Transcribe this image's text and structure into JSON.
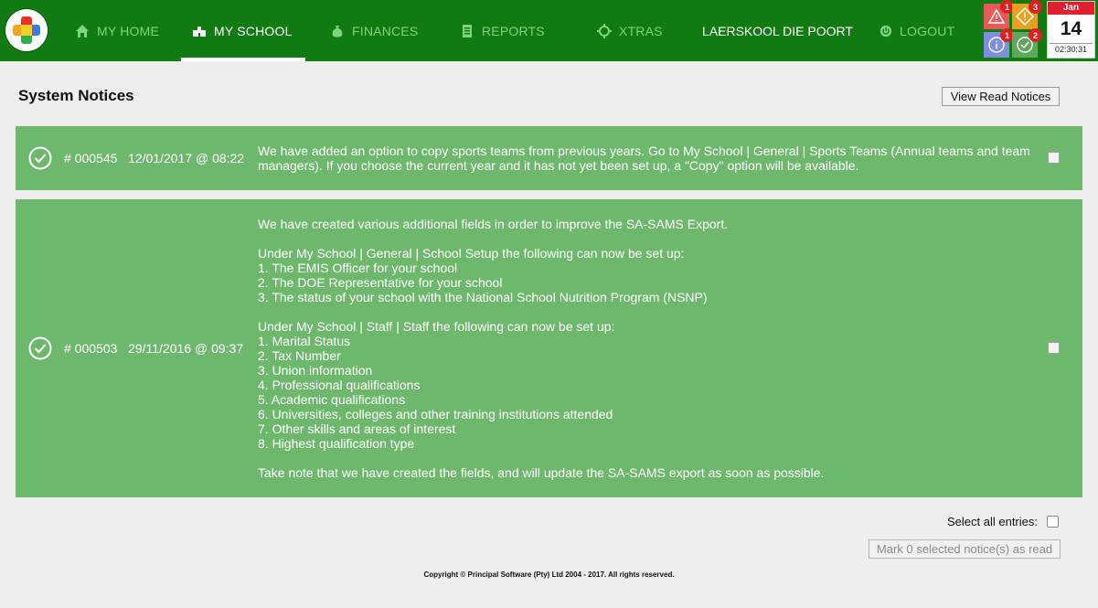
{
  "nav": {
    "items": [
      {
        "label": "MY HOME",
        "icon": "home-icon"
      },
      {
        "label": "MY SCHOOL",
        "icon": "school-icon",
        "active": true
      },
      {
        "label": "FINANCES",
        "icon": "money-bag-icon"
      },
      {
        "label": "REPORTS",
        "icon": "report-icon"
      },
      {
        "label": "XTRAS",
        "icon": "crosshair-icon"
      }
    ],
    "school_name": "LAERSKOOL DIE POORT",
    "logout": {
      "label": "LOGOUT",
      "icon": "power-icon"
    }
  },
  "notifications": [
    {
      "icon": "warning-triangle-icon",
      "count": "1",
      "color": "#e85a5a"
    },
    {
      "icon": "warning-diamond-icon",
      "count": "3",
      "color": "#e8a020"
    },
    {
      "icon": "info-icon",
      "count": "1",
      "color": "#7f8fe0"
    },
    {
      "icon": "check-icon",
      "count": "2",
      "color": "#5ea85e"
    }
  ],
  "calendar": {
    "month": "Jan",
    "day": "14",
    "time": "02:30:31"
  },
  "page": {
    "title": "System Notices",
    "view_read_button": "View Read Notices"
  },
  "notices": [
    {
      "number": "# 000545",
      "date": "12/01/2017 @ 08:22",
      "text": "We have added an option to copy sports teams from previous years. Go to My School | General | Sports Teams (Annual teams and team managers). If you choose the current year and it has not yet been set up, a \"Copy\" option will be available."
    },
    {
      "number": "# 000503",
      "date": "29/11/2016 @ 09:37",
      "text": "We have created various additional fields in order to improve the SA-SAMS Export.\n\nUnder My School | General | School Setup the following can now be set up:\n1. The EMIS Officer for your school\n2. The DOE Representative for your school\n3. The status of your school with the National School Nutrition Program (NSNP)\n\nUnder My School | Staff | Staff the following can now be set up:\n1. Marital Status\n2. Tax Number\n3. Union information\n4. Professional qualifications\n5. Academic qualifications\n6. Universities, colleges and other training institutions attended\n7. Other skills and areas of interest\n8. Highest qualification type\n\nTake note that we have created the fields, and will update the SA-SAMS export as soon as possible."
    }
  ],
  "footer": {
    "select_all_label": "Select all entries:",
    "mark_read_button": "Mark 0 selected notice(s) as read",
    "copyright": "Copyright © Principal Software (Pty) Ltd 2004 - 2017. All rights reserved."
  }
}
